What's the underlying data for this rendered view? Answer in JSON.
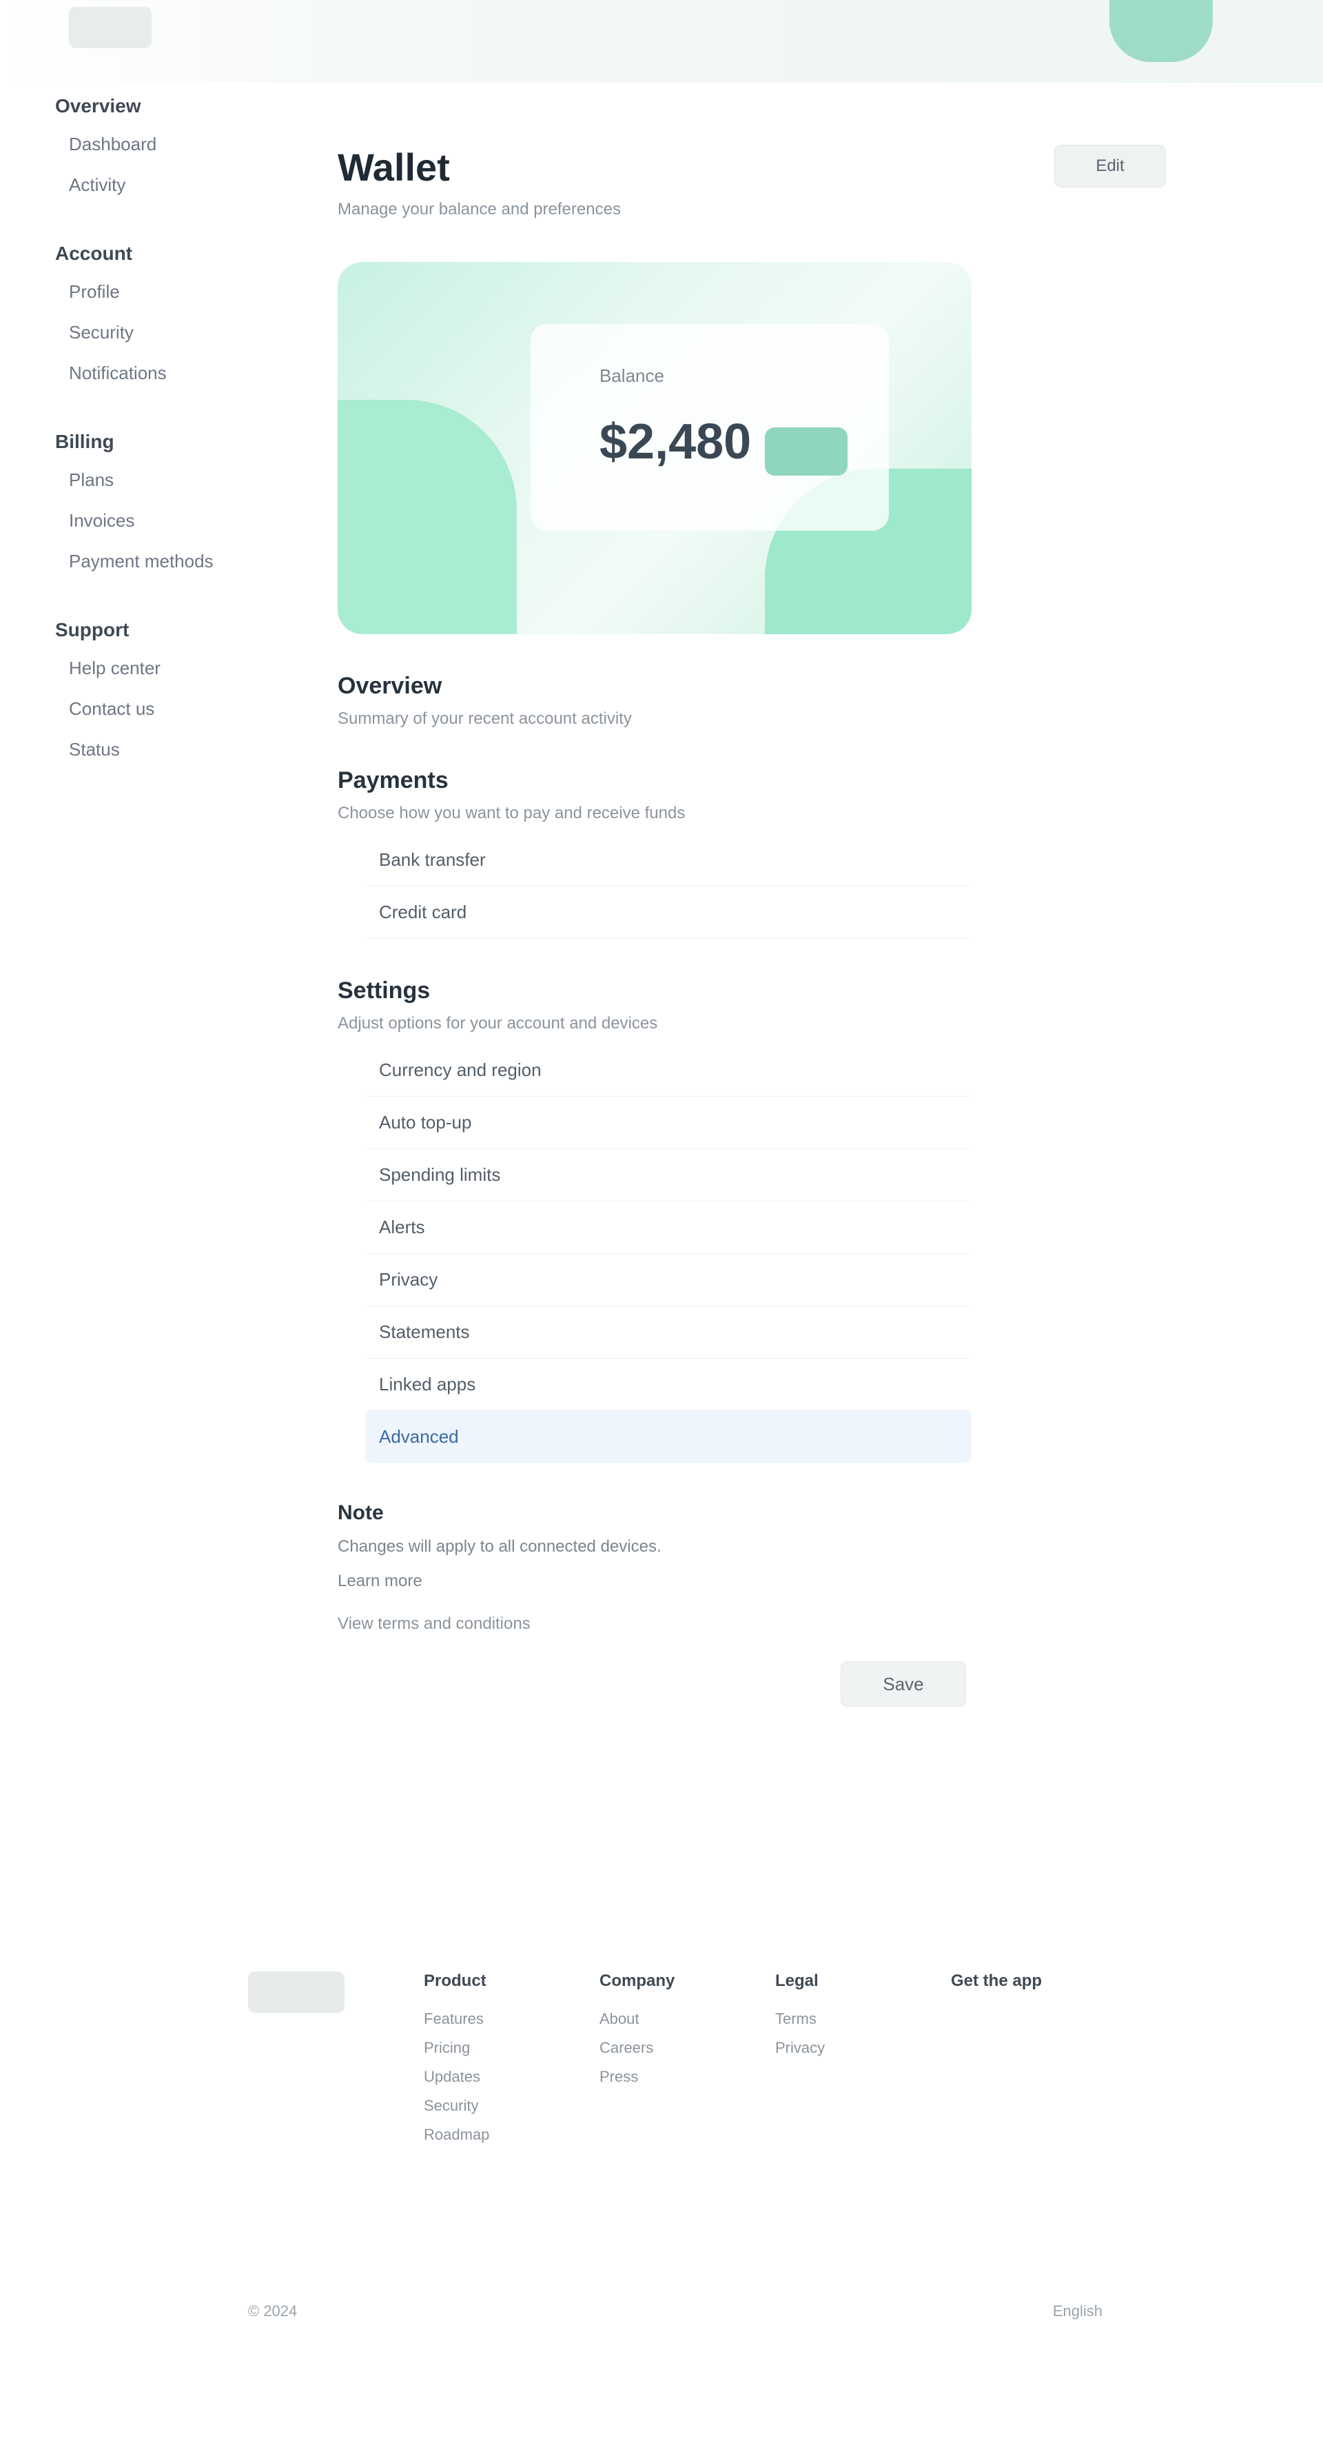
{
  "sidebar": {
    "sections": [
      {
        "heading": "Overview",
        "items": [
          "Dashboard",
          "Activity"
        ]
      },
      {
        "heading": "Account",
        "items": [
          "Profile",
          "Security",
          "Notifications"
        ]
      },
      {
        "heading": "Billing",
        "items": [
          "Plans",
          "Invoices",
          "Payment methods"
        ]
      },
      {
        "heading": "Support",
        "items": [
          "Help center",
          "Contact us",
          "Status"
        ]
      }
    ]
  },
  "header": {
    "action_label": "Edit"
  },
  "main": {
    "title": "Wallet",
    "subtitle": "Manage your balance and preferences",
    "hero": {
      "label": "Balance",
      "value": "$2,480"
    },
    "sections": [
      {
        "title": "Overview",
        "desc": "Summary of your recent account activity"
      },
      {
        "title": "Payments",
        "desc": "Choose how you want to pay and receive funds",
        "items": [
          "Bank transfer",
          "Credit card"
        ]
      },
      {
        "title": "Settings",
        "desc": "Adjust options for your account and devices",
        "items": [
          "Currency and region",
          "Auto top-up",
          "Spending limits",
          "Alerts",
          "Privacy",
          "Statements",
          "Linked apps",
          "Advanced"
        ]
      }
    ],
    "note": {
      "title": "Note",
      "text": "Changes will apply to all connected devices.",
      "text2": "Learn more",
      "link": "View terms and conditions"
    },
    "save_label": "Save"
  },
  "footer": {
    "cols": [
      {
        "head": "Product",
        "links": [
          "Features",
          "Pricing",
          "Updates",
          "Security",
          "Roadmap"
        ]
      },
      {
        "head": "Company",
        "links": [
          "About",
          "Careers",
          "Press"
        ]
      },
      {
        "head": "Legal",
        "links": [
          "Terms",
          "Privacy"
        ]
      },
      {
        "head": "Get the app",
        "links": []
      }
    ],
    "copyright": "© 2024",
    "lang": "English"
  }
}
